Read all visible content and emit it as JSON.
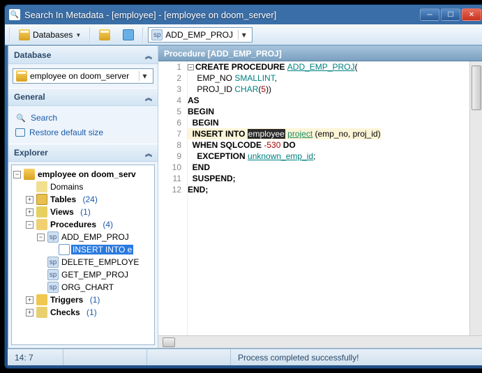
{
  "window": {
    "title": "Search In Metadata - [employee] - [employee on doom_server]"
  },
  "toolbar": {
    "databases_label": "Databases",
    "proc_selector": "ADD_EMP_PROJ"
  },
  "sidebar": {
    "panels": {
      "database": {
        "title": "Database",
        "db_selector": "employee on doom_server"
      },
      "general": {
        "title": "General",
        "search": "Search",
        "restore": "Restore default size"
      },
      "explorer": {
        "title": "Explorer"
      }
    },
    "tree": {
      "root": "employee on doom_serv",
      "domains": "Domains",
      "tables": "Tables",
      "tables_count": "(24)",
      "views": "Views",
      "views_count": "(1)",
      "procedures": "Procedures",
      "procedures_count": "(4)",
      "proc_items": {
        "add": "ADD_EMP_PROJ",
        "ins": "INSERT INTO e",
        "del": "DELETE_EMPLOYE",
        "get": "GET_EMP_PROJ",
        "org": "ORG_CHART"
      },
      "triggers": "Triggers",
      "triggers_count": "(1)",
      "checks": "Checks",
      "checks_count": "(1)"
    }
  },
  "editor": {
    "title": "Procedure [ADD_EMP_PROJ]",
    "lines": {
      "l1_a": "CREATE PROCEDURE ",
      "l1_b": "ADD_EMP_PROJ",
      "l1_c": "(",
      "l2_a": "    EMP_NO ",
      "l2_b": "SMALLINT",
      "l2_c": ",",
      "l3_a": "    PROJ_ID ",
      "l3_b": "CHAR",
      "l3_c": "(",
      "l3_d": "5",
      "l3_e": "))",
      "l4": "AS",
      "l5": "BEGIN",
      "l6": "  BEGIN",
      "l7_a": "  INSERT INTO ",
      "l7_b": "employee",
      "l7_c": " ",
      "l7_d": "project",
      "l7_e": " (emp_no, proj_id)",
      "l8_a": "  WHEN SQLCODE ",
      "l8_b": "-530",
      "l8_c": " DO",
      "l9_a": "    EXCEPTION ",
      "l9_b": "unknown_emp_id",
      "l9_c": ";",
      "l10": "  END",
      "l11": "  SUSPEND;",
      "l12": "END;"
    },
    "line_numbers": [
      "1",
      "2",
      "3",
      "4",
      "5",
      "6",
      "7",
      "8",
      "9",
      "10",
      "11",
      "12"
    ]
  },
  "status": {
    "cursor": "14:   7",
    "message": "Process completed successfully!"
  }
}
